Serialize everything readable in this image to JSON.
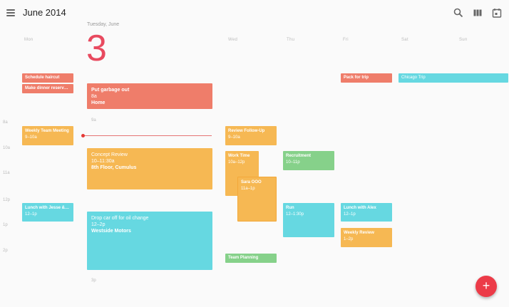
{
  "header": {
    "title": "June 2014",
    "icons": [
      "menu-icon",
      "search-icon",
      "week-view-icon",
      "today-icon"
    ]
  },
  "days": [
    "Mon",
    "Wed",
    "Thu",
    "Fri",
    "Sat",
    "Sun"
  ],
  "today": {
    "label": "Tuesday, June",
    "number": "3"
  },
  "time_labels": [
    "8a",
    "10a",
    "11a",
    "12p",
    "1p",
    "2p"
  ],
  "extra_labels": {
    "tue_9a": "9a",
    "tue_3p": "3p"
  },
  "events": [
    {
      "title": "Schedule haircut",
      "detail": ""
    },
    {
      "title": "Make dinner reservat...",
      "detail": ""
    },
    {
      "title": "Weekly Team Meeting",
      "detail": "9–10a"
    },
    {
      "title": "Lunch with Jesse &Ale...",
      "detail": "12–1p"
    },
    {
      "title": "Put garbage out",
      "detail": "8a",
      "detail2": "Home"
    },
    {
      "title": "Concept Review",
      "detail": "10–11:30a",
      "detail2": "8th Floor, Cumulus"
    },
    {
      "title": "Drop car off for oil change",
      "detail": "12–2p",
      "detail2": "Westside Motors"
    },
    {
      "title": "Review Follow-Up",
      "detail": "9–10a"
    },
    {
      "title": "Work Time",
      "detail": "10a–12p"
    },
    {
      "title": "Sara OOO",
      "detail": "11a–1p"
    },
    {
      "title": "Team Planning",
      "detail": ""
    },
    {
      "title": "Recruitment",
      "detail": "10–11p"
    },
    {
      "title": "Run",
      "detail": "12–1:30p"
    },
    {
      "title": "Pack for trip",
      "detail": ""
    },
    {
      "title": "Lunch with Alex",
      "detail": "12–1p"
    },
    {
      "title": "Weekly Review",
      "detail": "1–2p"
    },
    {
      "title": "Chicago Trip",
      "detail": ""
    }
  ],
  "fab": {
    "label": "+"
  },
  "colors": {
    "red": "#ef7d6a",
    "orange": "#f6b853",
    "teal": "#66d8e1",
    "green": "#86d18a",
    "accent": "#e84a5f",
    "fab": "#ec3b48"
  }
}
